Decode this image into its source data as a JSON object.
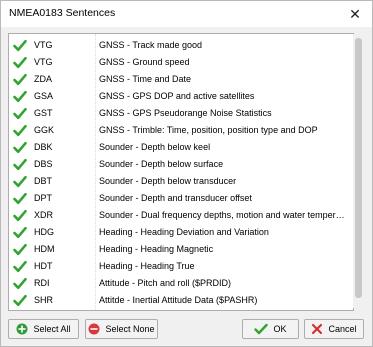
{
  "window": {
    "title": "NMEA0183 Sentences",
    "close_glyph": "✕"
  },
  "sentences": [
    {
      "code": "VTG",
      "desc": "GNSS - Track made good",
      "checked": true
    },
    {
      "code": "VTG",
      "desc": "GNSS - Ground speed",
      "checked": true
    },
    {
      "code": "ZDA",
      "desc": "GNSS - Time and Date",
      "checked": true
    },
    {
      "code": "GSA",
      "desc": "GNSS - GPS DOP and active satellites",
      "checked": true
    },
    {
      "code": "GST",
      "desc": "GNSS - GPS Pseudorange Noise Statistics",
      "checked": true
    },
    {
      "code": "GGK",
      "desc": "GNSS - Trimble: Time, position, position type and DOP",
      "checked": true
    },
    {
      "code": "DBK",
      "desc": "Sounder - Depth below keel",
      "checked": true
    },
    {
      "code": "DBS",
      "desc": "Sounder - Depth below surface",
      "checked": true
    },
    {
      "code": "DBT",
      "desc": "Sounder - Depth below transducer",
      "checked": true
    },
    {
      "code": "DPT",
      "desc": "Sounder - Depth and transducer offset",
      "checked": true
    },
    {
      "code": "XDR",
      "desc": "Sounder - Dual frequency depths, motion and water temper…",
      "checked": true
    },
    {
      "code": "HDG",
      "desc": "Heading - Heading Deviation and Variation",
      "checked": true
    },
    {
      "code": "HDM",
      "desc": "Heading - Heading Magnetic",
      "checked": true
    },
    {
      "code": "HDT",
      "desc": "Heading - Heading True",
      "checked": true
    },
    {
      "code": "RDI",
      "desc": "Attitude - Pitch and roll ($PRDID)",
      "checked": true
    },
    {
      "code": "SHR",
      "desc": "Attitde - Inertial Attitude Data ($PASHR)",
      "checked": true
    }
  ],
  "buttons": {
    "select_all": "Select All",
    "select_none": "Select None",
    "ok": "OK",
    "cancel": "Cancel"
  },
  "colors": {
    "check_green": "#2fa52f",
    "add_green": "#2e9b3a",
    "remove_red": "#d9393a",
    "cancel_red": "#d23030"
  }
}
